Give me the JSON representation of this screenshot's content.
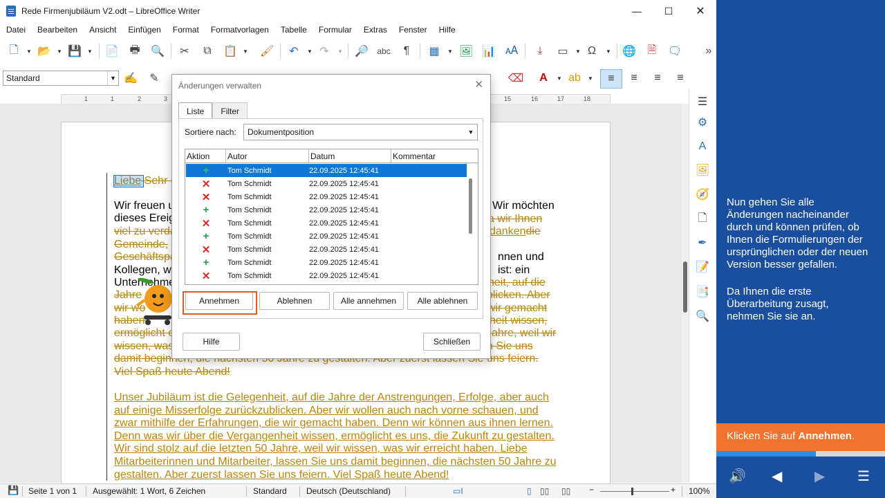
{
  "window": {
    "title": "Rede Firmenjubiläum V2.odt – LibreOffice Writer"
  },
  "menu": [
    "Datei",
    "Bearbeiten",
    "Ansicht",
    "Einfügen",
    "Format",
    "Formatvorlagen",
    "Tabelle",
    "Formular",
    "Extras",
    "Fenster",
    "Hilfe"
  ],
  "formatting": {
    "paragraph_style": "Standard"
  },
  "document": {
    "lines": [
      {
        "segs": [
          {
            "t": "Liebe",
            "c": "ins"
          },
          {
            "t": " Sehr g",
            "c": "del"
          }
        ]
      },
      {
        "segs": [
          {
            "t": "Wir freuen u",
            "c": "blk"
          }
        ]
      },
      {
        "segs": [
          {
            "t": "dieses Ereig",
            "c": "blk"
          }
        ]
      },
      {
        "segs": [
          {
            "t": "viel zu verda",
            "c": "del"
          }
        ]
      },
      {
        "segs": [
          {
            "t": "Gemeinde, ",
            "c": "del"
          }
        ]
      },
      {
        "segs": [
          {
            "t": "Geschäftspa",
            "c": "del"
          }
        ]
      },
      {
        "segs": [
          {
            "t": "Kollegen, wa",
            "c": "blk"
          }
        ]
      },
      {
        "segs": [
          {
            "t": "Unternehmen",
            "c": "blk"
          }
        ]
      },
      {
        "segs": [
          {
            "t": "Jahre",
            "c": "del"
          }
        ]
      },
      {
        "segs": [
          {
            "t": "wir wo",
            "c": "del"
          }
        ]
      },
      {
        "segs": [
          {
            "t": "haben.",
            "c": "del"
          }
        ]
      },
      {
        "segs": [
          {
            "t": "ermöglicht e",
            "c": "del"
          }
        ]
      },
      {
        "segs": [
          {
            "t": "wissen, was",
            "c": "del"
          }
        ]
      },
      {
        "segs": [
          {
            "t": "damit beginnen, die nächsten 50 Jahre zu gestalten. Aber zuerst lassen Sie uns feiern.",
            "c": "del"
          }
        ]
      },
      {
        "segs": [
          {
            "t": "Viel Spaß heute Abend!",
            "c": "del"
          }
        ]
      }
    ],
    "right_fragments": [
      {
        "segs": [
          {
            "t": "Wir möchten",
            "c": "blk"
          }
        ]
      },
      {
        "segs": [
          {
            "t": "a wir Ihnen",
            "c": "del"
          }
        ]
      },
      {
        "segs": [
          {
            "t": "danken",
            "c": "ins"
          },
          {
            "t": "die",
            "c": "del"
          }
        ]
      },
      {
        "segs": [
          {
            "t": "nnen und",
            "c": "blk"
          }
        ]
      },
      {
        "segs": [
          {
            "t": "ist: ein",
            "c": "blk"
          }
        ]
      },
      {
        "segs": [
          {
            "t": "heit, auf die",
            "c": "del"
          }
        ]
      },
      {
        "segs": [
          {
            "t": "blicken. Aber",
            "c": "del"
          }
        ]
      },
      {
        "segs": [
          {
            "t": "wir gemacht",
            "c": "del"
          }
        ]
      },
      {
        "segs": [
          {
            "t": "heit wissen,",
            "c": "del"
          }
        ]
      },
      {
        "segs": [
          {
            "t": "Jahre, weil wir",
            "c": "del"
          }
        ]
      },
      {
        "segs": [
          {
            "t": "n Sie uns",
            "c": "del"
          }
        ]
      }
    ],
    "inserted_paragraph": [
      "Unser Jubiläum ist die Gelegenheit, auf die Jahre der Anstrengungen, Erfolge, aber auch",
      "auf einige Misserfolge zurückzublicken. Aber wir wollen auch nach vorne schauen, und",
      "zwar mithilfe der Erfahrungen, die wir gemacht haben. Denn wir können aus ihnen lernen.",
      "Denn was wir über die Vergangenheit wissen, ermöglicht es uns, die Zukunft zu gestalten.",
      "Wir sind stolz auf die letzten 50 Jahre, weil wir wissen, was wir erreicht haben. Liebe",
      "Mitarbeiterinnen und Mitarbeiter, lassen Sie uns damit beginnen, die nächsten 50 Jahre zu",
      "gestalten. Aber zuerst lassen Sie uns feiern. Viel Spaß heute Abend!"
    ]
  },
  "dialog": {
    "title": "Änderungen verwalten",
    "tabs": [
      "Liste",
      "Filter"
    ],
    "sort_label": "Sortiere nach:",
    "sort_value": "Dokumentposition",
    "columns": [
      "Aktion",
      "Autor",
      "Datum",
      "Kommentar"
    ],
    "rows": [
      {
        "action": "+",
        "author": "Tom Schmidt",
        "date": "22.09.2025 12:45:41",
        "selected": true
      },
      {
        "action": "✕",
        "author": "Tom Schmidt",
        "date": "22.09.2025 12:45:41"
      },
      {
        "action": "✕",
        "author": "Tom Schmidt",
        "date": "22.09.2025 12:45:41"
      },
      {
        "action": "+",
        "author": "Tom Schmidt",
        "date": "22.09.2025 12:45:41"
      },
      {
        "action": "✕",
        "author": "Tom Schmidt",
        "date": "22.09.2025 12:45:41"
      },
      {
        "action": "+",
        "author": "Tom Schmidt",
        "date": "22.09.2025 12:45:41"
      },
      {
        "action": "✕",
        "author": "Tom Schmidt",
        "date": "22.09.2025 12:45:41"
      },
      {
        "action": "+",
        "author": "Tom Schmidt",
        "date": "22.09.2025 12:45:41"
      },
      {
        "action": "✕",
        "author": "Tom Schmidt",
        "date": "22.09.2025 12:45:41"
      }
    ],
    "buttons": {
      "accept": "Annehmen",
      "reject": "Ablehnen",
      "accept_all": "Alle annehmen",
      "reject_all": "Alle ablehnen",
      "help": "Hilfe",
      "close": "Schließen"
    }
  },
  "statusbar": {
    "page": "Seite 1 von 1",
    "selection": "Ausgewählt: 1 Wort, 6 Zeichen",
    "style": "Standard",
    "language": "Deutsch (Deutschland)",
    "zoom": "100%"
  },
  "tutorial": {
    "text1": [
      "Nun gehen Sie alle",
      "Änderungen nacheinander",
      "durch und können prüfen, ob",
      "Ihnen die Formulierungen der",
      "ursprünglichen oder der neuen",
      "Version besser gefallen."
    ],
    "text2": [
      "Da Ihnen die erste",
      "Überarbeitung zusagt,",
      "nehmen Sie sie an."
    ],
    "cta_prefix": "Klicken Sie auf ",
    "cta_bold": "Annehmen",
    "cta_suffix": ".",
    "progress": 0.59
  },
  "colors": {
    "tutorial_bg": "#1a4fa0",
    "cta": "#f1732e",
    "selection": "#0f78d7",
    "tracked_change": "#b8860b",
    "highlight_box": "#e05a27"
  }
}
